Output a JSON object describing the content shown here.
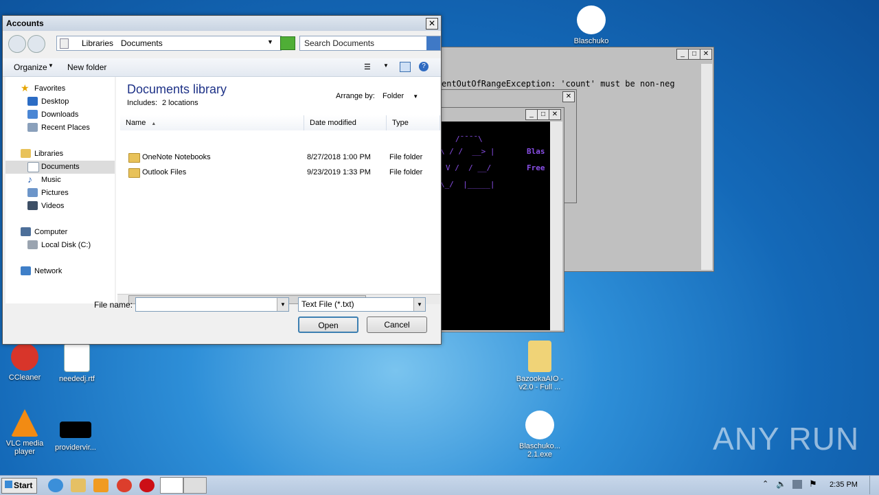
{
  "desktop": {
    "icons": [
      {
        "label": "Blaschuko"
      },
      {
        "label": "CCleaner"
      },
      {
        "label": "neededj.rtf"
      },
      {
        "label": "BazookaAIO - v2.0 - Full ..."
      },
      {
        "label": "VLC media player"
      },
      {
        "label": "providervir..."
      },
      {
        "label": "Blaschuko... 2.1.exe"
      }
    ],
    "watermark": "ANY RUN"
  },
  "console_error": "entOutOfRangeException: 'count' must be non-neg",
  "console_ascii": {
    "line1": "/¯¯¯¯\\",
    "line2": "\\ / /  __> |",
    "line3": "V /  / __/",
    "line4": "\\_/  |_____|",
    "right1": "Blas",
    "right2": "Free"
  },
  "dialog": {
    "title": "Accounts",
    "breadcrumb": [
      "Libraries",
      "Documents"
    ],
    "search_placeholder": "Search Documents",
    "toolbar": {
      "organize": "Organize",
      "new_folder": "New folder"
    },
    "nav": {
      "favorites": "Favorites",
      "desktop": "Desktop",
      "downloads": "Downloads",
      "recent": "Recent Places",
      "libraries": "Libraries",
      "documents": "Documents",
      "music": "Music",
      "pictures": "Pictures",
      "videos": "Videos",
      "computer": "Computer",
      "local_disk": "Local Disk (C:)",
      "network": "Network"
    },
    "library": {
      "title": "Documents library",
      "includes_label": "Includes:",
      "includes_link": "2 locations",
      "arrange_label": "Arrange by:",
      "arrange_value": "Folder"
    },
    "columns": {
      "name": "Name",
      "date": "Date modified",
      "type": "Type"
    },
    "files": [
      {
        "name": "OneNote Notebooks",
        "date": "8/27/2018 1:00 PM",
        "type": "File folder"
      },
      {
        "name": "Outlook Files",
        "date": "9/23/2019 1:33 PM",
        "type": "File folder"
      }
    ],
    "file_name_label": "File name:",
    "file_name_value": "",
    "file_type": "Text File (*.txt)",
    "open": "Open",
    "cancel": "Cancel"
  },
  "taskbar": {
    "start": "Start",
    "clock": "2:35 PM"
  }
}
